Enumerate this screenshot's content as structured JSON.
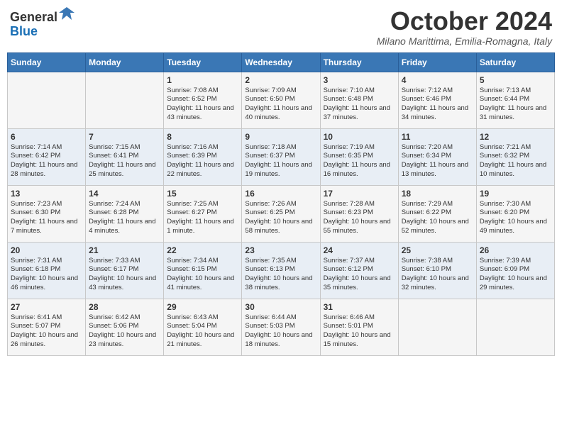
{
  "header": {
    "logo_line1": "General",
    "logo_line2": "Blue",
    "month": "October 2024",
    "location": "Milano Marittima, Emilia-Romagna, Italy"
  },
  "days_of_week": [
    "Sunday",
    "Monday",
    "Tuesday",
    "Wednesday",
    "Thursday",
    "Friday",
    "Saturday"
  ],
  "weeks": [
    [
      {
        "day": "",
        "content": ""
      },
      {
        "day": "",
        "content": ""
      },
      {
        "day": "1",
        "content": "Sunrise: 7:08 AM\nSunset: 6:52 PM\nDaylight: 11 hours and 43 minutes."
      },
      {
        "day": "2",
        "content": "Sunrise: 7:09 AM\nSunset: 6:50 PM\nDaylight: 11 hours and 40 minutes."
      },
      {
        "day": "3",
        "content": "Sunrise: 7:10 AM\nSunset: 6:48 PM\nDaylight: 11 hours and 37 minutes."
      },
      {
        "day": "4",
        "content": "Sunrise: 7:12 AM\nSunset: 6:46 PM\nDaylight: 11 hours and 34 minutes."
      },
      {
        "day": "5",
        "content": "Sunrise: 7:13 AM\nSunset: 6:44 PM\nDaylight: 11 hours and 31 minutes."
      }
    ],
    [
      {
        "day": "6",
        "content": "Sunrise: 7:14 AM\nSunset: 6:42 PM\nDaylight: 11 hours and 28 minutes."
      },
      {
        "day": "7",
        "content": "Sunrise: 7:15 AM\nSunset: 6:41 PM\nDaylight: 11 hours and 25 minutes."
      },
      {
        "day": "8",
        "content": "Sunrise: 7:16 AM\nSunset: 6:39 PM\nDaylight: 11 hours and 22 minutes."
      },
      {
        "day": "9",
        "content": "Sunrise: 7:18 AM\nSunset: 6:37 PM\nDaylight: 11 hours and 19 minutes."
      },
      {
        "day": "10",
        "content": "Sunrise: 7:19 AM\nSunset: 6:35 PM\nDaylight: 11 hours and 16 minutes."
      },
      {
        "day": "11",
        "content": "Sunrise: 7:20 AM\nSunset: 6:34 PM\nDaylight: 11 hours and 13 minutes."
      },
      {
        "day": "12",
        "content": "Sunrise: 7:21 AM\nSunset: 6:32 PM\nDaylight: 11 hours and 10 minutes."
      }
    ],
    [
      {
        "day": "13",
        "content": "Sunrise: 7:23 AM\nSunset: 6:30 PM\nDaylight: 11 hours and 7 minutes."
      },
      {
        "day": "14",
        "content": "Sunrise: 7:24 AM\nSunset: 6:28 PM\nDaylight: 11 hours and 4 minutes."
      },
      {
        "day": "15",
        "content": "Sunrise: 7:25 AM\nSunset: 6:27 PM\nDaylight: 11 hours and 1 minute."
      },
      {
        "day": "16",
        "content": "Sunrise: 7:26 AM\nSunset: 6:25 PM\nDaylight: 10 hours and 58 minutes."
      },
      {
        "day": "17",
        "content": "Sunrise: 7:28 AM\nSunset: 6:23 PM\nDaylight: 10 hours and 55 minutes."
      },
      {
        "day": "18",
        "content": "Sunrise: 7:29 AM\nSunset: 6:22 PM\nDaylight: 10 hours and 52 minutes."
      },
      {
        "day": "19",
        "content": "Sunrise: 7:30 AM\nSunset: 6:20 PM\nDaylight: 10 hours and 49 minutes."
      }
    ],
    [
      {
        "day": "20",
        "content": "Sunrise: 7:31 AM\nSunset: 6:18 PM\nDaylight: 10 hours and 46 minutes."
      },
      {
        "day": "21",
        "content": "Sunrise: 7:33 AM\nSunset: 6:17 PM\nDaylight: 10 hours and 43 minutes."
      },
      {
        "day": "22",
        "content": "Sunrise: 7:34 AM\nSunset: 6:15 PM\nDaylight: 10 hours and 41 minutes."
      },
      {
        "day": "23",
        "content": "Sunrise: 7:35 AM\nSunset: 6:13 PM\nDaylight: 10 hours and 38 minutes."
      },
      {
        "day": "24",
        "content": "Sunrise: 7:37 AM\nSunset: 6:12 PM\nDaylight: 10 hours and 35 minutes."
      },
      {
        "day": "25",
        "content": "Sunrise: 7:38 AM\nSunset: 6:10 PM\nDaylight: 10 hours and 32 minutes."
      },
      {
        "day": "26",
        "content": "Sunrise: 7:39 AM\nSunset: 6:09 PM\nDaylight: 10 hours and 29 minutes."
      }
    ],
    [
      {
        "day": "27",
        "content": "Sunrise: 6:41 AM\nSunset: 5:07 PM\nDaylight: 10 hours and 26 minutes."
      },
      {
        "day": "28",
        "content": "Sunrise: 6:42 AM\nSunset: 5:06 PM\nDaylight: 10 hours and 23 minutes."
      },
      {
        "day": "29",
        "content": "Sunrise: 6:43 AM\nSunset: 5:04 PM\nDaylight: 10 hours and 21 minutes."
      },
      {
        "day": "30",
        "content": "Sunrise: 6:44 AM\nSunset: 5:03 PM\nDaylight: 10 hours and 18 minutes."
      },
      {
        "day": "31",
        "content": "Sunrise: 6:46 AM\nSunset: 5:01 PM\nDaylight: 10 hours and 15 minutes."
      },
      {
        "day": "",
        "content": ""
      },
      {
        "day": "",
        "content": ""
      }
    ]
  ]
}
